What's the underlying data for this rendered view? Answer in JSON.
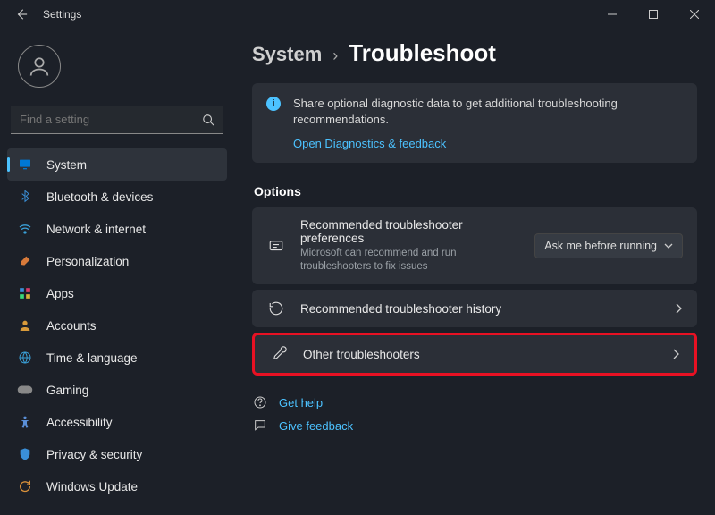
{
  "window": {
    "title": "Settings"
  },
  "search": {
    "placeholder": "Find a setting"
  },
  "sidebar": {
    "items": [
      {
        "label": "System",
        "selected": true,
        "icon": "monitor"
      },
      {
        "label": "Bluetooth & devices",
        "selected": false,
        "icon": "bluetooth"
      },
      {
        "label": "Network & internet",
        "selected": false,
        "icon": "wifi"
      },
      {
        "label": "Personalization",
        "selected": false,
        "icon": "brush"
      },
      {
        "label": "Apps",
        "selected": false,
        "icon": "apps"
      },
      {
        "label": "Accounts",
        "selected": false,
        "icon": "person"
      },
      {
        "label": "Time & language",
        "selected": false,
        "icon": "globe"
      },
      {
        "label": "Gaming",
        "selected": false,
        "icon": "game"
      },
      {
        "label": "Accessibility",
        "selected": false,
        "icon": "access"
      },
      {
        "label": "Privacy & security",
        "selected": false,
        "icon": "shield"
      },
      {
        "label": "Windows Update",
        "selected": false,
        "icon": "update"
      }
    ]
  },
  "breadcrumb": {
    "parent": "System",
    "sep": "›",
    "current": "Troubleshoot"
  },
  "infobar": {
    "message": "Share optional diagnostic data to get additional troubleshooting recommendations.",
    "link": "Open Diagnostics & feedback"
  },
  "options": {
    "title": "Options",
    "cards": [
      {
        "title": "Recommended troubleshooter preferences",
        "sub": "Microsoft can recommend and run troubleshooters to fix issues",
        "control": "dropdown",
        "value": "Ask me before running"
      },
      {
        "title": "Recommended troubleshooter history",
        "control": "nav"
      },
      {
        "title": "Other troubleshooters",
        "control": "nav",
        "highlight": true
      }
    ]
  },
  "footer": {
    "help": "Get help",
    "feedback": "Give feedback"
  }
}
